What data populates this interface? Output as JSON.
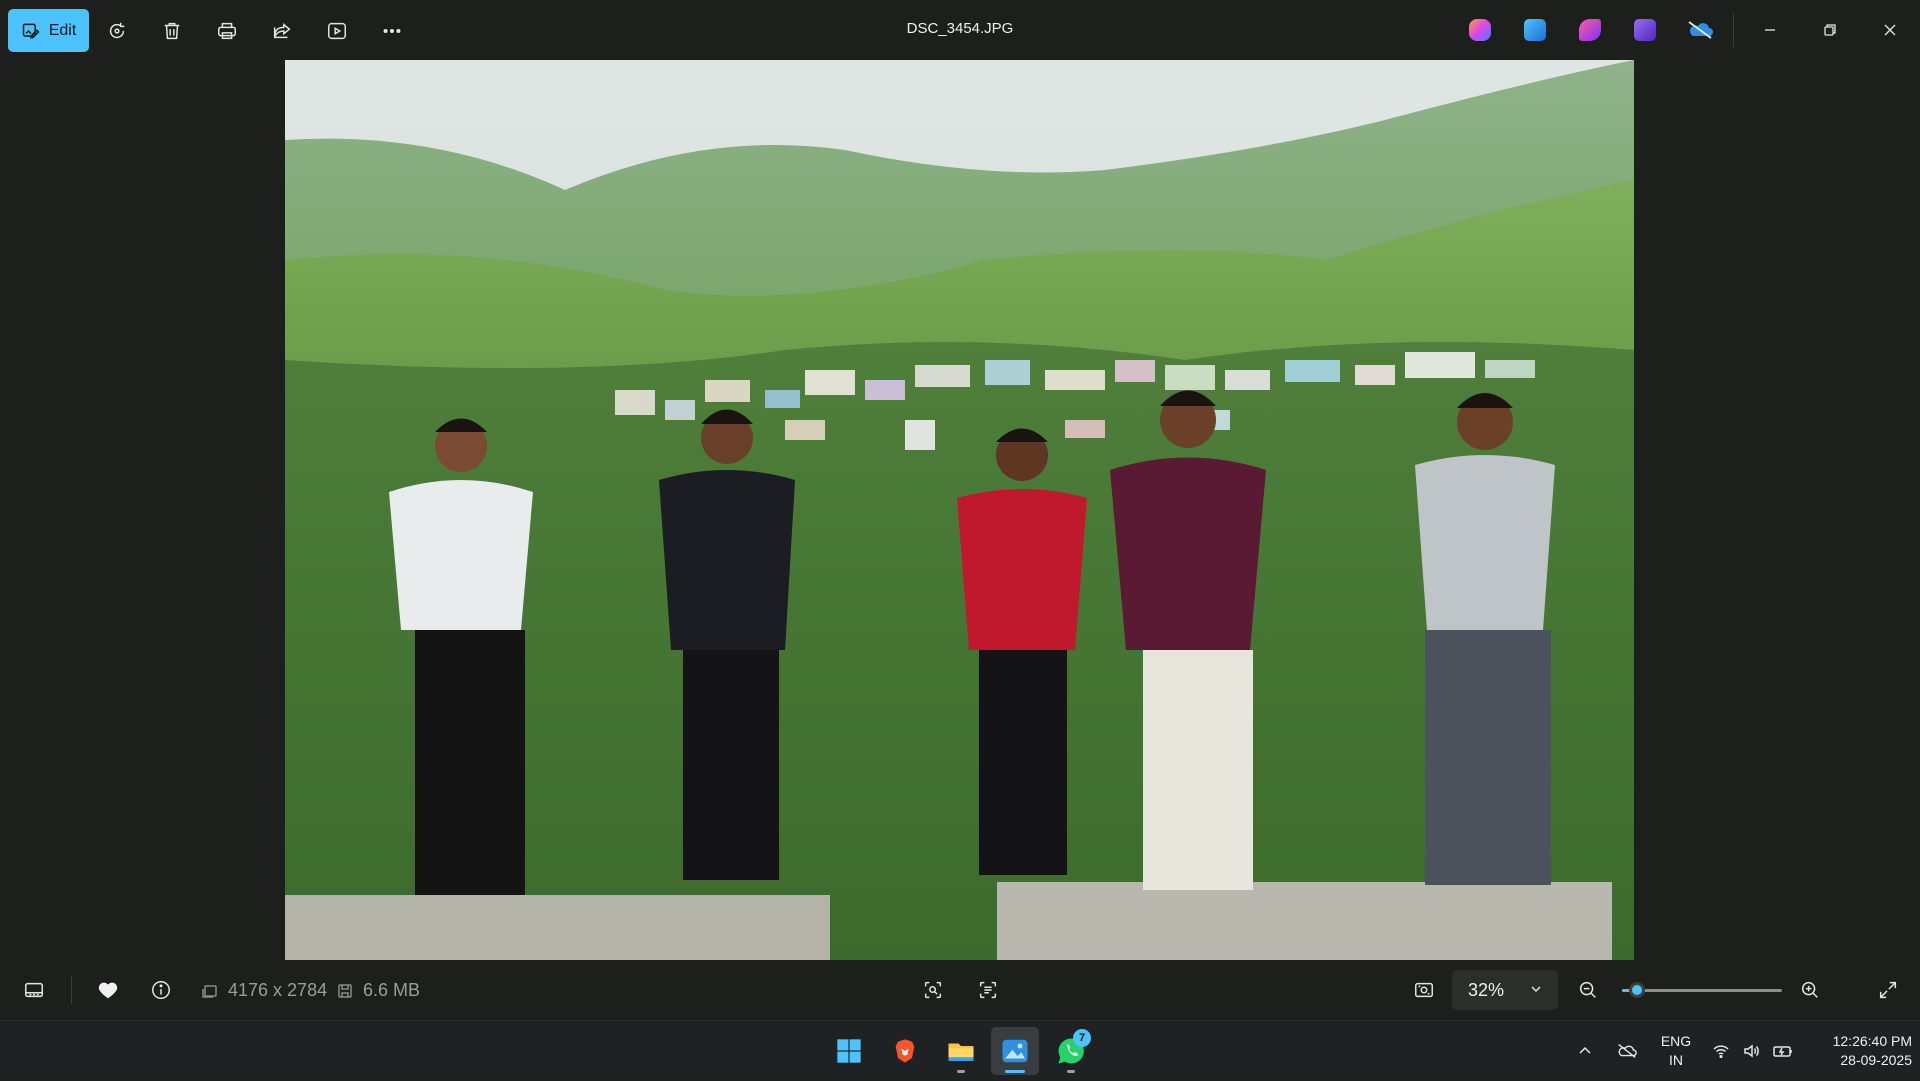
{
  "window": {
    "title": "DSC_3454.JPG",
    "edit_label": "Edit"
  },
  "toolbar": {
    "buttons": [
      "rotate-icon",
      "delete-icon",
      "print-icon",
      "share-icon",
      "slideshow-icon",
      "more-icon"
    ]
  },
  "app_icons": [
    {
      "name": "copilot-icon",
      "color": "#7b6cf6"
    },
    {
      "name": "photos-icon",
      "color": "#2f8fe0"
    },
    {
      "name": "designer-icon",
      "color": "#b23df0"
    },
    {
      "name": "clipchamp-icon",
      "color": "#6a4bd8"
    },
    {
      "name": "onedrive-offline-icon",
      "color": "#2f8fe0"
    }
  ],
  "photo": {
    "alt": "Five young men standing on a concrete wall in front of green tea-plantation hills and a hillside town"
  },
  "info": {
    "dimensions": "4176 x 2784",
    "file_size": "6.6 MB",
    "zoom_label": "32%",
    "zoom_level": 0.05
  },
  "taskbar": {
    "apps": [
      "start-button",
      "brave-browser",
      "file-explorer",
      "photos-app",
      "whatsapp"
    ],
    "whatsapp_badge": "7",
    "lang_line1": "ENG",
    "lang_line2": "IN",
    "time": "12:26:40 PM",
    "date": "28-09-2025"
  },
  "colors": {
    "accent": "#4cc2ff",
    "background": "#1c1f1c",
    "taskbar": "#1f2225"
  }
}
